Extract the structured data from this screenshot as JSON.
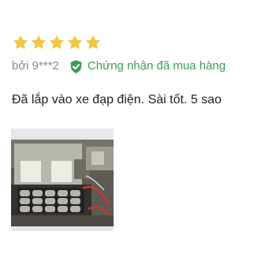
{
  "review": {
    "rating": 5,
    "max_rating": 5,
    "star_color": "#f4c542",
    "author": "bởi 9***2",
    "verified_label": "Chứng nhận đã mua hàng",
    "verified_color": "#3f9a58",
    "comment": "Đã lắp vào xe đạp điện. Sài tốt. 5 sao",
    "photo_alt": "Ảnh đánh giá",
    "icons": {
      "star": "star-icon",
      "verified": "check-shield-icon"
    }
  }
}
